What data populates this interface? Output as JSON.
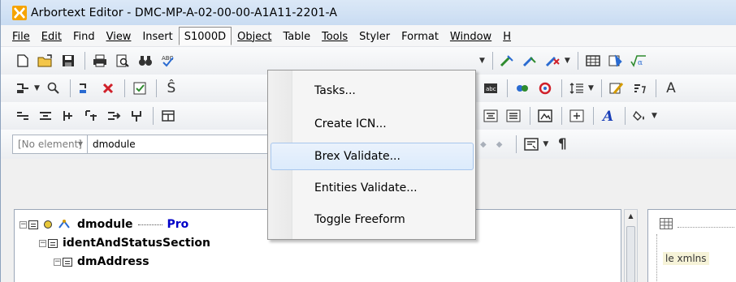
{
  "window": {
    "title": "Arbortext Editor - DMC-MP-A-02-00-00-A1A11-2201-A"
  },
  "menubar": {
    "items": [
      {
        "label": "File"
      },
      {
        "label": "Edit"
      },
      {
        "label": "Find"
      },
      {
        "label": "View"
      },
      {
        "label": "Insert"
      },
      {
        "label": "S1000D"
      },
      {
        "label": "Object"
      },
      {
        "label": "Table"
      },
      {
        "label": "Tools"
      },
      {
        "label": "Styler"
      },
      {
        "label": "Format"
      },
      {
        "label": "Window"
      },
      {
        "label": "H"
      }
    ],
    "open_menu": "S1000D"
  },
  "s1000d_menu": {
    "items": [
      {
        "label": "Tasks..."
      },
      {
        "label": "Create ICN..."
      },
      {
        "label": "Brex Validate..."
      },
      {
        "label": "Entities Validate..."
      },
      {
        "label": "Toggle Freeform"
      }
    ],
    "highlighted": "Brex Validate..."
  },
  "element_bar": {
    "element_placeholder": "[No element]",
    "context_value": "dmodule"
  },
  "tree": {
    "rows": [
      {
        "label": "dmodule",
        "suffix": "Pro"
      },
      {
        "label": "identAndStatusSection"
      },
      {
        "label": "dmAddress"
      }
    ]
  },
  "right_pane": {
    "snippet": "le xmlns"
  },
  "colors": {
    "titlebar": "#c9dcf2",
    "menu_highlight": "#dcebfc",
    "tree_link": "#0000c8"
  }
}
